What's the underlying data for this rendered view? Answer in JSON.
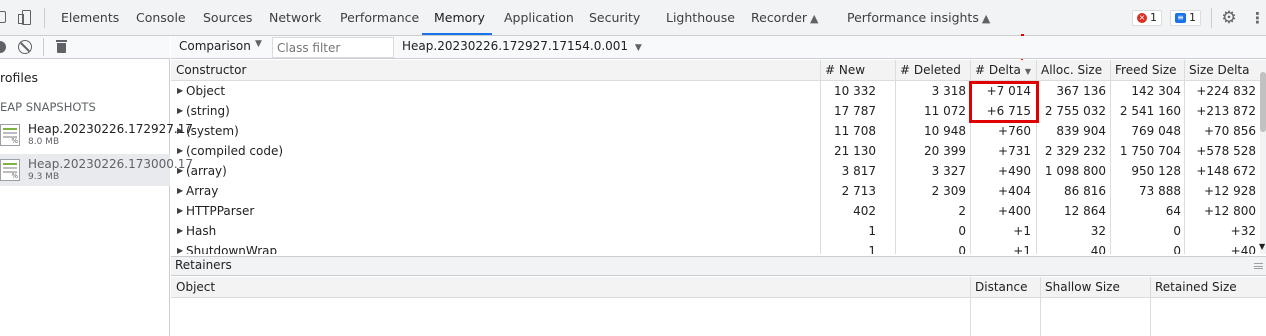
{
  "devtools": {
    "tabs": [
      "Elements",
      "Console",
      "Sources",
      "Network",
      "Performance",
      "Memory",
      "Application",
      "Security",
      "Lighthouse",
      "Recorder",
      "Performance insights"
    ],
    "active_tab": "Memory",
    "errors_count": "1",
    "messages_count": "1"
  },
  "profiles": {
    "title": "rofiles",
    "section_label": "EAP SNAPSHOTS",
    "snapshots": [
      {
        "name": "Heap.20230226.172927.17",
        "size": "8.0 MB"
      },
      {
        "name": "Heap.20230226.173000.17",
        "size": "9.3 MB"
      }
    ]
  },
  "toolbar": {
    "view_mode": "Comparison",
    "class_filter_placeholder": "Class filter",
    "base_snapshot": "Heap.20230226.172927.17154.0.001"
  },
  "table": {
    "columns": [
      "Constructor",
      "# New",
      "# Deleted",
      "# Delta",
      "Alloc. Size",
      "Freed Size",
      "Size Delta"
    ],
    "rows": [
      {
        "name": "Object",
        "new": "10 332",
        "deleted": "3 318",
        "delta": "+7 014",
        "alloc": "367 136",
        "freed": "142 304",
        "size_delta": "+224 832"
      },
      {
        "name": "(string)",
        "new": "17 787",
        "deleted": "11 072",
        "delta": "+6 715",
        "alloc": "2 755 032",
        "freed": "2 541 160",
        "size_delta": "+213 872"
      },
      {
        "name": "(system)",
        "new": "11 708",
        "deleted": "10 948",
        "delta": "+760",
        "alloc": "839 904",
        "freed": "769 048",
        "size_delta": "+70 856"
      },
      {
        "name": "(compiled code)",
        "new": "21 130",
        "deleted": "20 399",
        "delta": "+731",
        "alloc": "2 329 232",
        "freed": "1 750 704",
        "size_delta": "+578 528"
      },
      {
        "name": "(array)",
        "new": "3 817",
        "deleted": "3 327",
        "delta": "+490",
        "alloc": "1 098 800",
        "freed": "950 128",
        "size_delta": "+148 672"
      },
      {
        "name": "Array",
        "new": "2 713",
        "deleted": "2 309",
        "delta": "+404",
        "alloc": "86 816",
        "freed": "73 888",
        "size_delta": "+12 928"
      },
      {
        "name": "HTTPParser",
        "new": "402",
        "deleted": "2",
        "delta": "+400",
        "alloc": "12 864",
        "freed": "64",
        "size_delta": "+12 800"
      },
      {
        "name": "Hash",
        "new": "1",
        "deleted": "0",
        "delta": "+1",
        "alloc": "32",
        "freed": "0",
        "size_delta": "+32"
      },
      {
        "name": "ShutdownWrap",
        "new": "1",
        "deleted": "0",
        "delta": "+1",
        "alloc": "40",
        "freed": "0",
        "size_delta": "+40"
      }
    ]
  },
  "retainers": {
    "title": "Retainers",
    "columns": [
      "Object",
      "Distance",
      "Shallow Size",
      "Retained Size"
    ]
  }
}
